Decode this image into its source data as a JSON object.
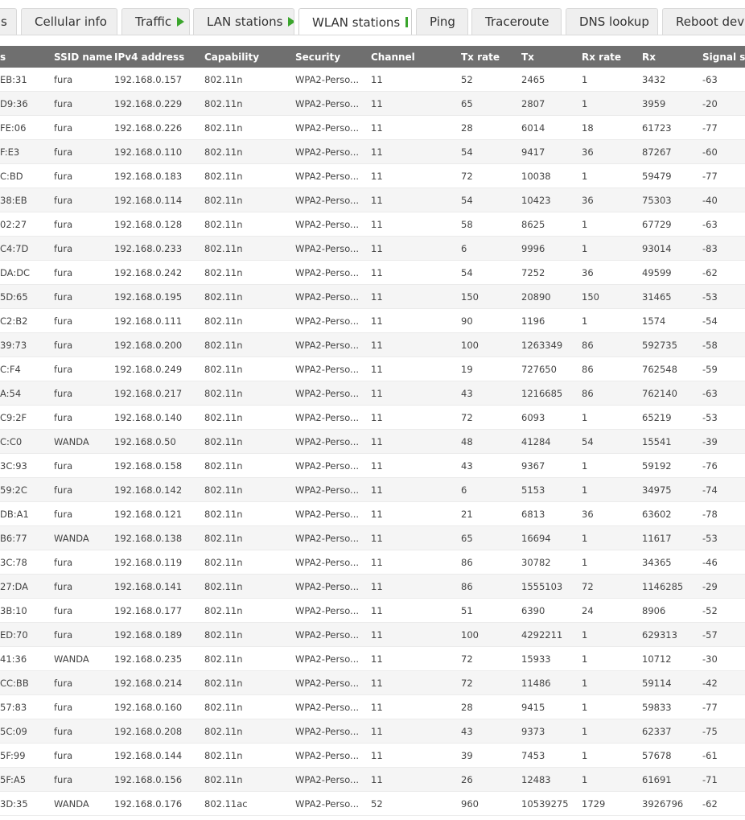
{
  "tabs": [
    {
      "label": "s",
      "active": false,
      "indicator": ""
    },
    {
      "label": "Cellular info",
      "active": false,
      "indicator": ""
    },
    {
      "label": "Traffic",
      "active": false,
      "indicator": "play-icon"
    },
    {
      "label": "LAN stations",
      "active": false,
      "indicator": "play-icon"
    },
    {
      "label": "WLAN stations",
      "active": true,
      "indicator": "pause-icon"
    },
    {
      "label": "Ping",
      "active": false,
      "indicator": ""
    },
    {
      "label": "Traceroute",
      "active": false,
      "indicator": ""
    },
    {
      "label": "DNS lookup",
      "active": false,
      "indicator": ""
    },
    {
      "label": "Reboot devi",
      "active": false,
      "indicator": ""
    }
  ],
  "colors": {
    "accent_green": "#3aa52c",
    "header_bg": "#6f6f6f"
  },
  "table": {
    "headers": [
      "s",
      "SSID name",
      "IPv4 address",
      "Capability",
      "Security",
      "Channel",
      "Tx rate",
      "Tx",
      "Rx rate",
      "Rx",
      "Signal st"
    ],
    "rows": [
      [
        "EB:31",
        "fura",
        "192.168.0.157",
        "802.11n",
        "WPA2-Perso...",
        "11",
        "52",
        "2465",
        "1",
        "3432",
        "-63"
      ],
      [
        "D9:36",
        "fura",
        "192.168.0.229",
        "802.11n",
        "WPA2-Perso...",
        "11",
        "65",
        "2807",
        "1",
        "3959",
        "-20"
      ],
      [
        "FE:06",
        "fura",
        "192.168.0.226",
        "802.11n",
        "WPA2-Perso...",
        "11",
        "28",
        "6014",
        "18",
        "61723",
        "-77"
      ],
      [
        "F:E3",
        "fura",
        "192.168.0.110",
        "802.11n",
        "WPA2-Perso...",
        "11",
        "54",
        "9417",
        "36",
        "87267",
        "-60"
      ],
      [
        "C:BD",
        "fura",
        "192.168.0.183",
        "802.11n",
        "WPA2-Perso...",
        "11",
        "72",
        "10038",
        "1",
        "59479",
        "-77"
      ],
      [
        "38:EB",
        "fura",
        "192.168.0.114",
        "802.11n",
        "WPA2-Perso...",
        "11",
        "54",
        "10423",
        "36",
        "75303",
        "-40"
      ],
      [
        "02:27",
        "fura",
        "192.168.0.128",
        "802.11n",
        "WPA2-Perso...",
        "11",
        "58",
        "8625",
        "1",
        "67729",
        "-63"
      ],
      [
        "C4:7D",
        "fura",
        "192.168.0.233",
        "802.11n",
        "WPA2-Perso...",
        "11",
        "6",
        "9996",
        "1",
        "93014",
        "-83"
      ],
      [
        "DA:DC",
        "fura",
        "192.168.0.242",
        "802.11n",
        "WPA2-Perso...",
        "11",
        "54",
        "7252",
        "36",
        "49599",
        "-62"
      ],
      [
        "5D:65",
        "fura",
        "192.168.0.195",
        "802.11n",
        "WPA2-Perso...",
        "11",
        "150",
        "20890",
        "150",
        "31465",
        "-53"
      ],
      [
        "C2:B2",
        "fura",
        "192.168.0.111",
        "802.11n",
        "WPA2-Perso...",
        "11",
        "90",
        "1196",
        "1",
        "1574",
        "-54"
      ],
      [
        "39:73",
        "fura",
        "192.168.0.200",
        "802.11n",
        "WPA2-Perso...",
        "11",
        "100",
        "1263349",
        "86",
        "592735",
        "-58"
      ],
      [
        "C:F4",
        "fura",
        "192.168.0.249",
        "802.11n",
        "WPA2-Perso...",
        "11",
        "19",
        "727650",
        "86",
        "762548",
        "-59"
      ],
      [
        "A:54",
        "fura",
        "192.168.0.217",
        "802.11n",
        "WPA2-Perso...",
        "11",
        "43",
        "1216685",
        "86",
        "762140",
        "-63"
      ],
      [
        "C9:2F",
        "fura",
        "192.168.0.140",
        "802.11n",
        "WPA2-Perso...",
        "11",
        "72",
        "6093",
        "1",
        "65219",
        "-53"
      ],
      [
        "C:C0",
        "WANDA",
        "192.168.0.50",
        "802.11n",
        "WPA2-Perso...",
        "11",
        "48",
        "41284",
        "54",
        "15541",
        "-39"
      ],
      [
        "3C:93",
        "fura",
        "192.168.0.158",
        "802.11n",
        "WPA2-Perso...",
        "11",
        "43",
        "9367",
        "1",
        "59192",
        "-76"
      ],
      [
        "59:2C",
        "fura",
        "192.168.0.142",
        "802.11n",
        "WPA2-Perso...",
        "11",
        "6",
        "5153",
        "1",
        "34975",
        "-74"
      ],
      [
        "DB:A1",
        "fura",
        "192.168.0.121",
        "802.11n",
        "WPA2-Perso...",
        "11",
        "21",
        "6813",
        "36",
        "63602",
        "-78"
      ],
      [
        "B6:77",
        "WANDA",
        "192.168.0.138",
        "802.11n",
        "WPA2-Perso...",
        "11",
        "65",
        "16694",
        "1",
        "11617",
        "-53"
      ],
      [
        "3C:78",
        "fura",
        "192.168.0.119",
        "802.11n",
        "WPA2-Perso...",
        "11",
        "86",
        "30782",
        "1",
        "34365",
        "-46"
      ],
      [
        "27:DA",
        "fura",
        "192.168.0.141",
        "802.11n",
        "WPA2-Perso...",
        "11",
        "86",
        "1555103",
        "72",
        "1146285",
        "-29"
      ],
      [
        "3B:10",
        "fura",
        "192.168.0.177",
        "802.11n",
        "WPA2-Perso...",
        "11",
        "51",
        "6390",
        "24",
        "8906",
        "-52"
      ],
      [
        "ED:70",
        "fura",
        "192.168.0.189",
        "802.11n",
        "WPA2-Perso...",
        "11",
        "100",
        "4292211",
        "1",
        "629313",
        "-57"
      ],
      [
        "41:36",
        "WANDA",
        "192.168.0.235",
        "802.11n",
        "WPA2-Perso...",
        "11",
        "72",
        "15933",
        "1",
        "10712",
        "-30"
      ],
      [
        "CC:BB",
        "fura",
        "192.168.0.214",
        "802.11n",
        "WPA2-Perso...",
        "11",
        "72",
        "11486",
        "1",
        "59114",
        "-42"
      ],
      [
        "57:83",
        "fura",
        "192.168.0.160",
        "802.11n",
        "WPA2-Perso...",
        "11",
        "28",
        "9415",
        "1",
        "59833",
        "-77"
      ],
      [
        "5C:09",
        "fura",
        "192.168.0.208",
        "802.11n",
        "WPA2-Perso...",
        "11",
        "43",
        "9373",
        "1",
        "62337",
        "-75"
      ],
      [
        "5F:99",
        "fura",
        "192.168.0.144",
        "802.11n",
        "WPA2-Perso...",
        "11",
        "39",
        "7453",
        "1",
        "57678",
        "-61"
      ],
      [
        "5F:A5",
        "fura",
        "192.168.0.156",
        "802.11n",
        "WPA2-Perso...",
        "11",
        "26",
        "12483",
        "1",
        "61691",
        "-71"
      ],
      [
        "3D:35",
        "WANDA",
        "192.168.0.176",
        "802.11ac",
        "WPA2-Perso...",
        "52",
        "960",
        "10539275",
        "1729",
        "3926796",
        "-62"
      ]
    ]
  }
}
